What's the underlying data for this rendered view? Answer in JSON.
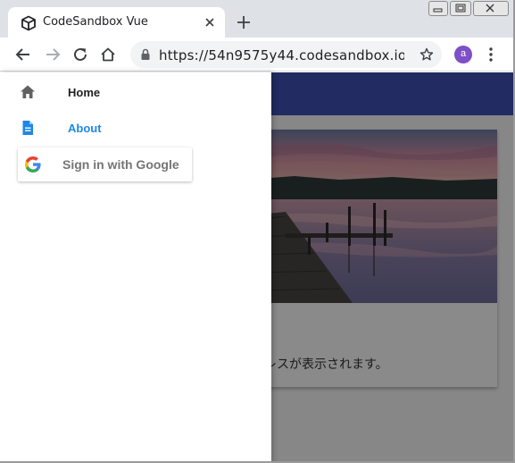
{
  "browser": {
    "tab_title": "CodeSandbox Vue",
    "url": "https://54n9575y44.codesandbox.io/⋯",
    "profile_initial": "a",
    "icons": {
      "favicon": "codesandbox-cube-icon",
      "tab_close": "close-icon",
      "new_tab": "plus-icon",
      "back": "arrow-left-icon",
      "forward": "arrow-right-icon",
      "reload": "reload-icon",
      "home": "home-icon",
      "lock": "lock-icon",
      "bookmark": "star-icon",
      "menu": "kebab-menu-icon",
      "minimize": "minimize-icon",
      "maximize": "restore-icon",
      "close_window": "close-window-icon"
    }
  },
  "page": {
    "app_bar_color": "#3f51b5",
    "card_text": "レスが表示されます。"
  },
  "drawer": {
    "items": [
      {
        "label": "Home",
        "icon": "home-icon",
        "color": "#212121"
      },
      {
        "label": "About",
        "icon": "document-icon",
        "color": "#1e88e5"
      }
    ],
    "google_button": {
      "label": "Sign in with Google",
      "icon": "google-g-icon"
    }
  }
}
